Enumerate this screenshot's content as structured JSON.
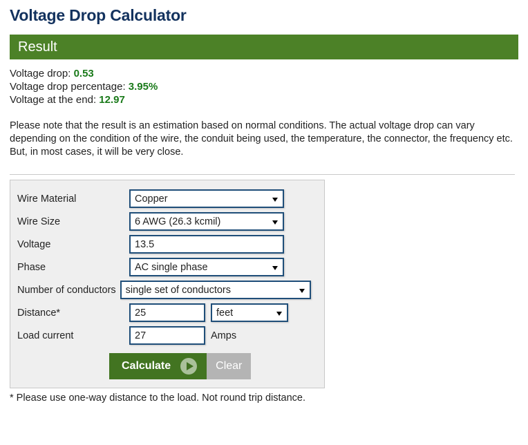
{
  "page": {
    "title": "Voltage Drop Calculator"
  },
  "result": {
    "header": "Result",
    "lines": [
      {
        "label": "Voltage drop: ",
        "value": "0.53"
      },
      {
        "label": "Voltage drop percentage: ",
        "value": "3.95%"
      },
      {
        "label": "Voltage at the end: ",
        "value": "12.97"
      }
    ],
    "note": "Please note that the result is an estimation based on normal conditions. The actual voltage drop can vary depending on the condition of the wire, the conduit being used, the temperature, the connector, the frequency etc. But, in most cases, it will be very close."
  },
  "form": {
    "wire_material": {
      "label": "Wire Material",
      "value": "Copper"
    },
    "wire_size": {
      "label": "Wire Size",
      "value": "6 AWG (26.3 kcmil)"
    },
    "voltage": {
      "label": "Voltage",
      "value": "13.5"
    },
    "phase": {
      "label": "Phase",
      "value": "AC single phase"
    },
    "conductors": {
      "label": "Number of conductors",
      "value": "single set of conductors"
    },
    "distance": {
      "label": "Distance*",
      "value": "25",
      "unit": "feet"
    },
    "load_current": {
      "label": "Load current",
      "value": "27",
      "unit": "Amps"
    },
    "calculate_label": "Calculate",
    "clear_label": "Clear"
  },
  "footnote": "* Please use one-way distance to the load. Not round trip distance.",
  "colors": {
    "title": "#13325e",
    "result_bar": "#4c8127",
    "result_value": "#1a7a1a",
    "control_border": "#1f4e79",
    "calculate_button": "#427421",
    "clear_button": "#b4b4b4",
    "panel_background": "#efefef"
  }
}
